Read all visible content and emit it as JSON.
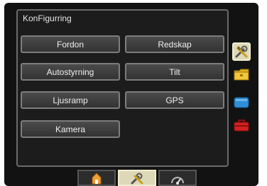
{
  "panel": {
    "title": "KonFigurring"
  },
  "buttons": [
    {
      "label": "Fordon"
    },
    {
      "label": "Redskap"
    },
    {
      "label": "Autostyrning"
    },
    {
      "label": "Tilt"
    },
    {
      "label": "Ljusramp"
    },
    {
      "label": "GPS"
    },
    {
      "label": "Kamera"
    }
  ],
  "side_tabs": [
    {
      "icon": "wrench-screwdriver-icon",
      "active": true
    },
    {
      "icon": "yellow-folder-icon",
      "active": false
    },
    {
      "icon": "blue-card-icon",
      "active": false
    },
    {
      "icon": "red-toolbox-icon",
      "active": false
    }
  ],
  "bottom_tabs": [
    {
      "icon": "home-icon",
      "active": false
    },
    {
      "icon": "wrench-screwdriver-icon",
      "active": true
    },
    {
      "icon": "gauge-icon",
      "active": false
    }
  ],
  "colors": {
    "background": "#121212",
    "panel": "#1c1c1c",
    "button": "#3f3f3f",
    "button_border": "#7d7d7d",
    "active_tab": "#ddd9b8",
    "text": "#f0f0f0"
  }
}
